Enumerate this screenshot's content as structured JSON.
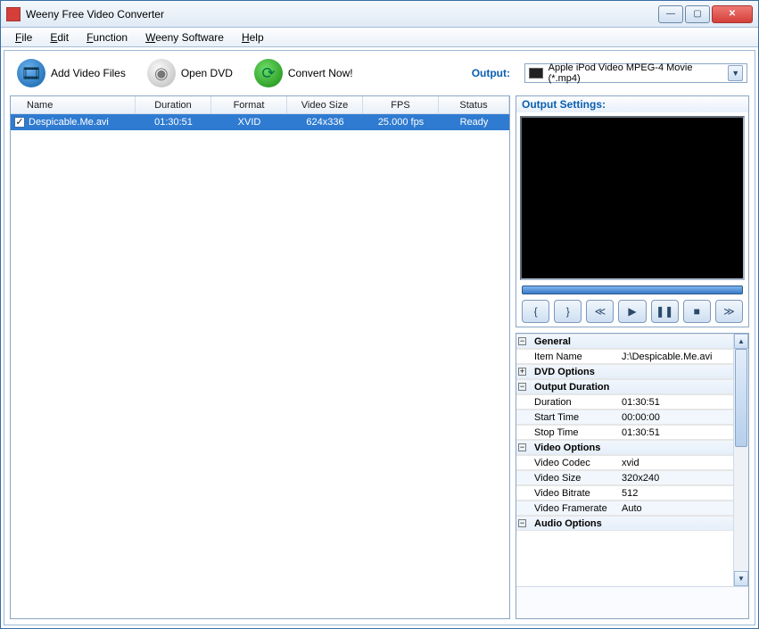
{
  "window": {
    "title": "Weeny Free Video Converter"
  },
  "menu": [
    "File",
    "Edit",
    "Function",
    "Weeny Software",
    "Help"
  ],
  "toolbar": {
    "add": "Add Video Files",
    "opendvd": "Open DVD",
    "convert": "Convert Now!",
    "output_label": "Output:",
    "output_value": "Apple iPod Video MPEG-4 Movie (*.mp4)"
  },
  "grid": {
    "headers": [
      "Name",
      "Duration",
      "Format",
      "Video Size",
      "FPS",
      "Status"
    ],
    "rows": [
      {
        "checked": true,
        "name": "Despicable.Me.avi",
        "duration": "01:30:51",
        "format": "XVID",
        "size": "624x336",
        "fps": "25.000 fps",
        "status": "Ready"
      }
    ]
  },
  "preview": {
    "title": "Output Settings:"
  },
  "settings": {
    "sections": [
      {
        "type": "section",
        "expand": "−",
        "name": "General"
      },
      {
        "type": "row",
        "name": "Item Name",
        "value": "J:\\Despicable.Me.avi"
      },
      {
        "type": "section",
        "expand": "+",
        "name": "DVD Options"
      },
      {
        "type": "section",
        "expand": "−",
        "name": "Output Duration"
      },
      {
        "type": "row",
        "name": "Duration",
        "value": "01:30:51"
      },
      {
        "type": "row",
        "name": "Start Time",
        "value": "00:00:00"
      },
      {
        "type": "row",
        "name": "Stop Time",
        "value": "01:30:51"
      },
      {
        "type": "section",
        "expand": "−",
        "name": "Video Options"
      },
      {
        "type": "row",
        "name": "Video Codec",
        "value": "xvid"
      },
      {
        "type": "row",
        "name": "Video Size",
        "value": "320x240"
      },
      {
        "type": "row",
        "name": "Video Bitrate",
        "value": "512"
      },
      {
        "type": "row",
        "name": "Video Framerate",
        "value": "Auto"
      },
      {
        "type": "section",
        "expand": "−",
        "name": "Audio Options"
      }
    ]
  }
}
